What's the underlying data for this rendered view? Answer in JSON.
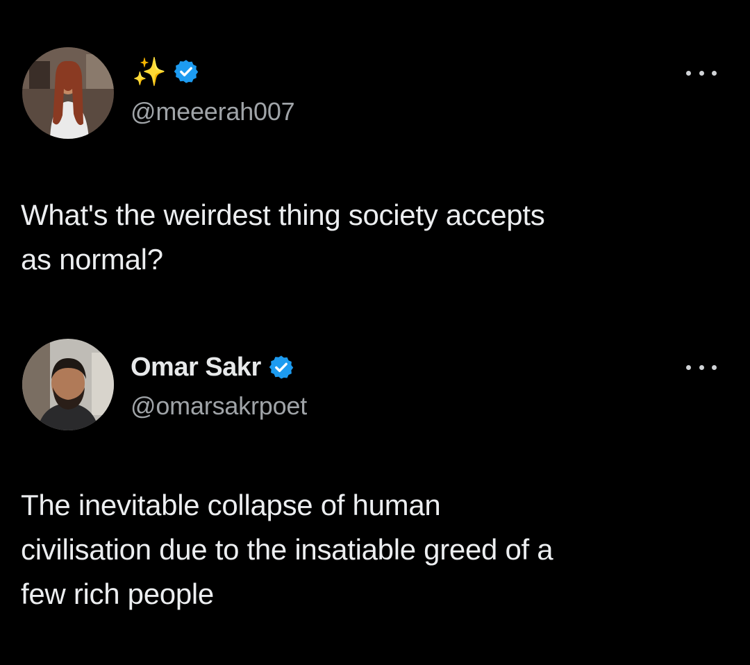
{
  "tweets": [
    {
      "display_name": "✨",
      "verified": true,
      "handle": "@meeerah007",
      "text_lines": [
        "What's the weirdest thing society accepts",
        "as normal?"
      ],
      "more_icon": "more-horizontal-icon"
    },
    {
      "display_name": "Omar Sakr",
      "verified": true,
      "handle": "@omarsakrpoet",
      "text_lines": [
        "The inevitable collapse of human",
        "civilisation due to the insatiable greed of a",
        "few rich people"
      ],
      "more_icon": "more-horizontal-icon"
    }
  ],
  "colors": {
    "background": "#000000",
    "primary_text": "#e7e9ea",
    "secondary_text": "#a0a4a8",
    "verified_blue": "#1d9bf0"
  }
}
